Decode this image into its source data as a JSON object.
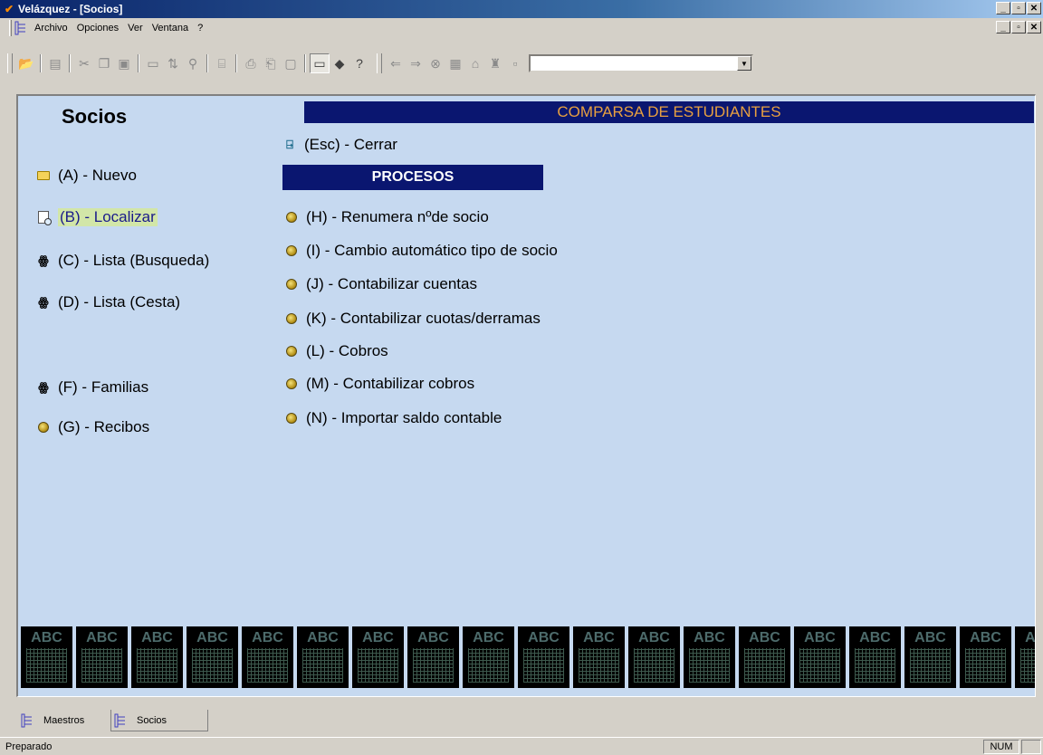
{
  "window": {
    "title": "Velázquez - [Socios]"
  },
  "menu": {
    "items": [
      {
        "label": "Archivo",
        "name": "menu-archivo"
      },
      {
        "label": "Opciones",
        "name": "menu-opciones"
      },
      {
        "label": "Ver",
        "name": "menu-ver"
      },
      {
        "label": "Ventana",
        "name": "menu-ventana"
      },
      {
        "label": "?",
        "name": "menu-help"
      }
    ]
  },
  "toolbar": {
    "combo_value": ""
  },
  "form": {
    "title": "Socios",
    "banner": "COMPARSA DE ESTUDIANTES",
    "close_label": "(Esc) - Cerrar",
    "procesos_header": "PROCESOS",
    "left_items": [
      {
        "label": "(A) - Nuevo",
        "icon": "folder-icon"
      },
      {
        "label": "(B) - Localizar",
        "icon": "document-search-icon"
      },
      {
        "label": "(C) - Lista (Busqueda)",
        "icon": "binoculars-icon"
      },
      {
        "label": "(D) - Lista (Cesta)",
        "icon": "binoculars-icon"
      },
      {
        "label": "(F) - Familias",
        "icon": "binoculars-icon"
      },
      {
        "label": "(G) - Recibos",
        "icon": "process-icon"
      }
    ],
    "process_items": [
      {
        "label": "(H) - Renumera nºde socio"
      },
      {
        "label": "(I) - Cambio automático tipo de socio"
      },
      {
        "label": "(J) - Contabilizar cuentas"
      },
      {
        "label": "(K) - Contabilizar cuotas/derramas"
      },
      {
        "label": "(L) - Cobros"
      },
      {
        "label": "(M) - Contabilizar cobros"
      },
      {
        "label": "(N) - Importar saldo contable"
      }
    ],
    "abc_label": "ABC"
  },
  "tabs": [
    {
      "label": "Maestros"
    },
    {
      "label": "Socios"
    }
  ],
  "status": {
    "text": "Preparado",
    "num": "NUM"
  }
}
